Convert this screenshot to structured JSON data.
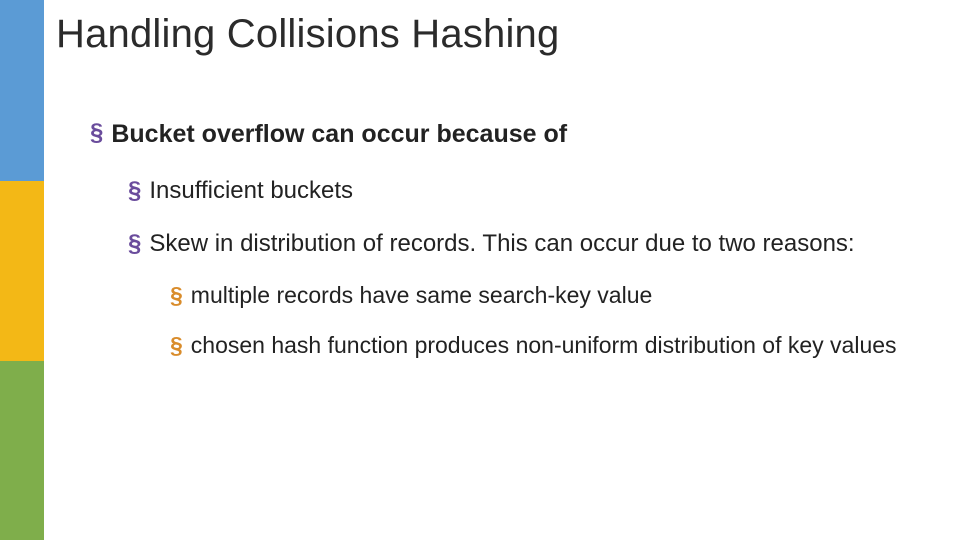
{
  "slide": {
    "title": "Handling Collisions Hashing",
    "l1": {
      "bullet": "§",
      "text": "Bucket overflow can occur because of"
    },
    "l2a": {
      "bullet": "§",
      "text": "Insufficient buckets"
    },
    "l2b": {
      "bullet": "§",
      "text": "Skew in distribution of records.  This can occur due to two reasons:"
    },
    "l3a": {
      "bullet": "§",
      "text": "multiple records have same search-key value"
    },
    "l3b": {
      "bullet": "§",
      "text": "chosen hash function produces non-uniform distribution of key values"
    }
  },
  "colors": {
    "sidebar_top": "#5b9bd5",
    "sidebar_mid": "#f3b816",
    "sidebar_bot": "#7fae4b",
    "bullet_primary": "#6a4c9c",
    "bullet_secondary": "#d98c2b"
  }
}
